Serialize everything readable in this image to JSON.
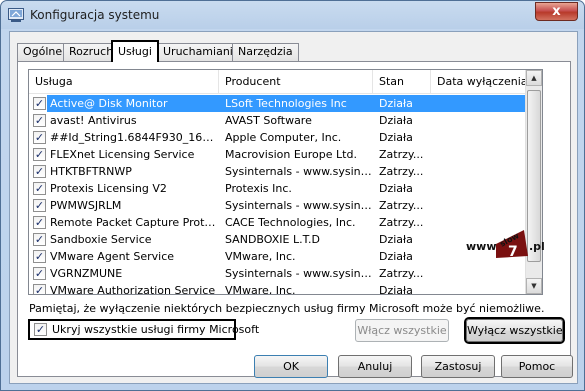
{
  "window": {
    "title": "Konfiguracja systemu",
    "close_label": "x"
  },
  "tabs": [
    {
      "label": "Ogólne"
    },
    {
      "label": "Rozruch"
    },
    {
      "label": "Usługi"
    },
    {
      "label": "Uruchamianie"
    },
    {
      "label": "Narzędzia"
    }
  ],
  "active_tab": "Usługi",
  "list": {
    "columns": [
      "Usługa",
      "Producent",
      "Stan",
      "Data wyłączenia"
    ],
    "rows": [
      {
        "checked": true,
        "service": "Active@ Disk Monitor",
        "vendor": "LSoft Technologies Inc",
        "status": "Działa"
      },
      {
        "checked": true,
        "service": "avast! Antivirus",
        "vendor": "AVAST Software",
        "status": "Działa"
      },
      {
        "checked": true,
        "service": "##Id_String1.6844F930_1628_...",
        "vendor": "Apple Computer, Inc.",
        "status": "Działa"
      },
      {
        "checked": true,
        "service": "FLEXnet Licensing Service",
        "vendor": "Macrovision Europe Ltd.",
        "status": "Zatrzy..."
      },
      {
        "checked": true,
        "service": "HTKTBFTRNWP",
        "vendor": "Sysinternals - www.sysint...",
        "status": "Zatrzy..."
      },
      {
        "checked": true,
        "service": "Protexis Licensing V2",
        "vendor": "Protexis Inc.",
        "status": "Działa"
      },
      {
        "checked": true,
        "service": "PWMWSJRLM",
        "vendor": "Sysinternals - www.sysint...",
        "status": "Zatrzy..."
      },
      {
        "checked": true,
        "service": "Remote Packet Capture Protocol...",
        "vendor": "CACE Technologies, Inc.",
        "status": "Zatrzy..."
      },
      {
        "checked": true,
        "service": "Sandboxie Service",
        "vendor": "SANDBOXIE L.T.D",
        "status": "Działa"
      },
      {
        "checked": true,
        "service": "VMware Agent Service",
        "vendor": "VMware, Inc.",
        "status": "Działa"
      },
      {
        "checked": true,
        "service": "VGRNZMUNE",
        "vendor": "Sysinternals - www.sysint...",
        "status": "Zatrzy..."
      },
      {
        "checked": true,
        "service": "VMware Authorization Service",
        "vendor": "VMware, Inc.",
        "status": "Działa"
      }
    ],
    "selected_row": 0
  },
  "watermark": {
    "prefix": "www.",
    "top_word": "slow",
    "number": "7",
    "suffix": ".pl"
  },
  "note": "Pamiętaj, że wyłączenie niektórych bezpiecznych usług firmy Microsoft może być niemożliwe.",
  "hide_ms": {
    "label": "Ukryj wszystkie usługi firmy Microsoft",
    "checked": true
  },
  "buttons": {
    "enable_all": "Włącz wszystkie",
    "disable_all": "Wyłącz wszystkie",
    "ok": "OK",
    "cancel": "Anuluj",
    "apply": "Zastosuj",
    "help": "Pomoc"
  }
}
